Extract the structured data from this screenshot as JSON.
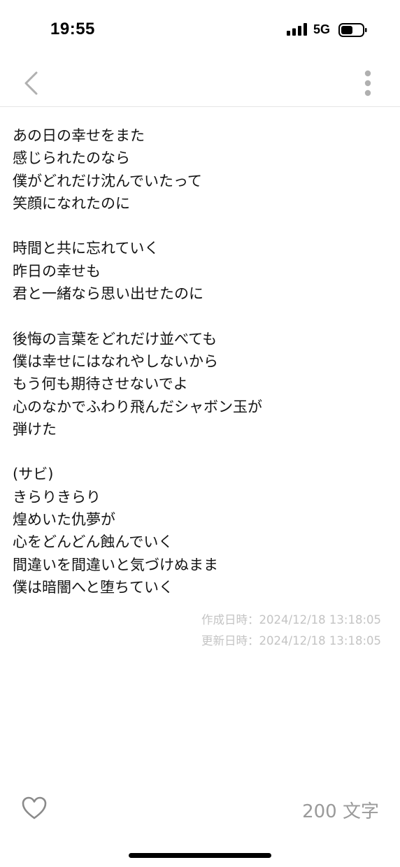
{
  "status_bar": {
    "time": "19:55",
    "network": "5G",
    "icons": [
      "signal-icon",
      "battery-icon"
    ]
  },
  "nav": {
    "icons": [
      "chevron-left-icon",
      "more-vertical-icon"
    ]
  },
  "lyrics": [
    "あの日の幸せをまた",
    "感じられたのなら",
    "僕がどれだけ沈んでいたって",
    "笑顔になれたのに",
    "",
    "時間と共に忘れていく",
    "昨日の幸せも",
    "君と一緒なら思い出せたのに",
    "",
    "後悔の言葉をどれだけ並べても",
    "僕は幸せにはなれやしないから",
    "もう何も期待させないでよ",
    "心のなかでふわり飛んだシャボン玉が",
    "弾けた",
    "",
    "(サビ)",
    "きらりきらり",
    "煌めいた仇夢が",
    "心をどんどん蝕んでいく",
    "間違いを間違いと気づけぬまま",
    "僕は暗闇へと堕ちていく"
  ],
  "meta": {
    "created": "作成日時：2024/12/18 13:18:05",
    "updated": "更新日時：2024/12/18 13:18:05"
  },
  "footer": {
    "char_count": "200 文字",
    "icons": [
      "heart-icon"
    ]
  },
  "colors": {
    "text": "#141414",
    "muted": "#c4c4c4",
    "count": "#9a9a9a",
    "icon": "#b0b0b0",
    "divider": "#e6e6e6"
  }
}
